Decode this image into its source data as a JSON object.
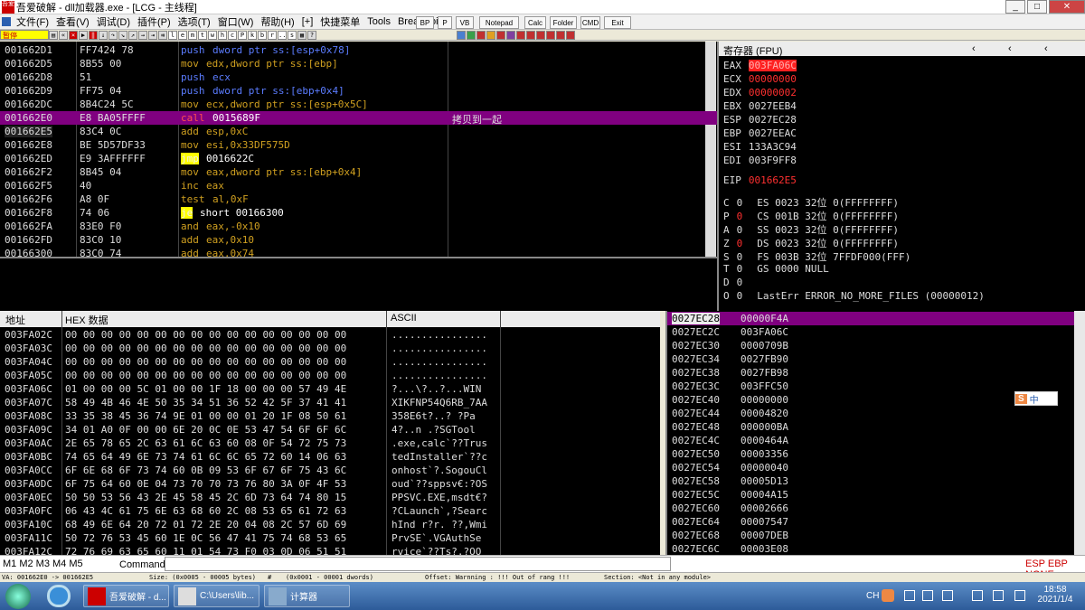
{
  "window": {
    "title": "吾爱破解 - dll加载器.exe - [LCG - 主线程]",
    "logo": "吾爱"
  },
  "menu": [
    "文件(F)",
    "查看(V)",
    "调试(D)",
    "插件(P)",
    "选项(T)",
    "窗口(W)",
    "帮助(H)",
    "[+]",
    "快捷菜单",
    "Tools",
    "BreakPoint"
  ],
  "toolbar": {
    "status": "暂停",
    "letters": [
      "l",
      "e",
      "m",
      "t",
      "w",
      "h",
      "c",
      "P",
      "k",
      "b",
      "r",
      "...",
      "s"
    ]
  },
  "tabs": [
    "BP",
    "P",
    "VB",
    "Notepad",
    "Calc",
    "Folder",
    "CMD",
    "Exit"
  ],
  "disasm": [
    {
      "addr": "001662D1",
      "hex": "FF7424 78",
      "mn": "push",
      "ops": "dword ptr ss:[esp+0x78]",
      "cmt": ""
    },
    {
      "addr": "001662D5",
      "hex": "8B55 00",
      "mn": "mov",
      "ops": "edx,dword ptr ss:[ebp]",
      "cmt": ""
    },
    {
      "addr": "001662D8",
      "hex": "51",
      "mn": "push",
      "ops": "ecx",
      "cmt": ""
    },
    {
      "addr": "001662D9",
      "hex": "FF75 04",
      "mn": "push",
      "ops": "dword ptr ss:[ebp+0x4]",
      "cmt": ""
    },
    {
      "addr": "001662DC",
      "hex": "8B4C24 5C",
      "mn": "mov",
      "ops": "ecx,dword ptr ss:[esp+0x5C]",
      "cmt": ""
    },
    {
      "addr": "001662E0",
      "hex": "E8 BA05FFFF",
      "mn": "call",
      "ops": "0015689F",
      "cmt": "拷贝到一起"
    },
    {
      "addr": "001662E5",
      "hex": "83C4 0C",
      "mn": "add",
      "ops": "esp,0xC",
      "cmt": ""
    },
    {
      "addr": "001662E8",
      "hex": "BE 5D57DF33",
      "mn": "mov",
      "ops": "esi,0x33DF575D",
      "cmt": ""
    },
    {
      "addr": "001662ED",
      "hex": "E9 3AFFFFFF",
      "mn": "jmp",
      "ops": "0016622C",
      "cmt": ""
    },
    {
      "addr": "001662F2",
      "hex": "8B45 04",
      "mn": "mov",
      "ops": "eax,dword ptr ss:[ebp+0x4]",
      "cmt": ""
    },
    {
      "addr": "001662F5",
      "hex": "40",
      "mn": "inc",
      "ops": "eax",
      "cmt": ""
    },
    {
      "addr": "001662F6",
      "hex": "A8 0F",
      "mn": "test",
      "ops": "al,0xF",
      "cmt": ""
    },
    {
      "addr": "001662F8",
      "hex": "74 06",
      "mn": "je",
      "ops": "short 00166300",
      "cmt": ""
    },
    {
      "addr": "001662FA",
      "hex": "83E0 F0",
      "mn": "and",
      "ops": "eax,-0x10",
      "cmt": ""
    },
    {
      "addr": "001662FD",
      "hex": "83C0 10",
      "mn": "add",
      "ops": "eax,0x10",
      "cmt": ""
    },
    {
      "addr": "00166300",
      "hex": "83C0 74",
      "mn": "add",
      "ops": "eax,0x74",
      "cmt": ""
    }
  ],
  "registers": {
    "title": "寄存器 (FPU)",
    "gpr": [
      {
        "n": "EAX",
        "v": "003FA06C",
        "s": "hl"
      },
      {
        "n": "ECX",
        "v": "00000000",
        "s": "red"
      },
      {
        "n": "EDX",
        "v": "00000002",
        "s": "red"
      },
      {
        "n": "EBX",
        "v": "0027EEB4",
        "s": ""
      },
      {
        "n": "ESP",
        "v": "0027EC28",
        "s": ""
      },
      {
        "n": "EBP",
        "v": "0027EEAC",
        "s": ""
      },
      {
        "n": "ESI",
        "v": "133A3C94",
        "s": ""
      },
      {
        "n": "EDI",
        "v": "003F9FF8",
        "s": ""
      }
    ],
    "eip": {
      "n": "EIP",
      "v": "001662E5"
    },
    "flags": [
      {
        "f": "C",
        "v": "0",
        "rest": "ES 0023 32位 0(FFFFFFFF)",
        "r": false
      },
      {
        "f": "P",
        "v": "0",
        "rest": "CS 001B 32位 0(FFFFFFFF)",
        "r": true
      },
      {
        "f": "A",
        "v": "0",
        "rest": "SS 0023 32位 0(FFFFFFFF)",
        "r": false
      },
      {
        "f": "Z",
        "v": "0",
        "rest": "DS 0023 32位 0(FFFFFFFF)",
        "r": true
      },
      {
        "f": "S",
        "v": "0",
        "rest": "FS 003B 32位 7FFDF000(FFF)",
        "r": false
      },
      {
        "f": "T",
        "v": "0",
        "rest": "GS 0000 NULL",
        "r": false
      },
      {
        "f": "D",
        "v": "0",
        "rest": "",
        "r": false
      },
      {
        "f": "O",
        "v": "0",
        "rest": "LastErr ERROR_NO_MORE_FILES (00000012)",
        "r": false
      }
    ]
  },
  "dump": {
    "headers": {
      "addr": "地址",
      "hex": "HEX 数据",
      "ascii": "ASCII"
    },
    "rows": [
      {
        "a": "003FA02C",
        "h": "00 00 00 00 00 00 00 00 00 00 00 00 00 00 00 00",
        "t": "................"
      },
      {
        "a": "003FA03C",
        "h": "00 00 00 00 00 00 00 00 00 00 00 00 00 00 00 00",
        "t": "................"
      },
      {
        "a": "003FA04C",
        "h": "00 00 00 00 00 00 00 00 00 00 00 00 00 00 00 00",
        "t": "................"
      },
      {
        "a": "003FA05C",
        "h": "00 00 00 00 00 00 00 00 00 00 00 00 00 00 00 00",
        "t": "................"
      },
      {
        "a": "003FA06C",
        "h": "01 00 00 00 5C 01 00 00 1F 18 00 00 00 57 49 4E",
        "t": "?...\\?..?...WIN"
      },
      {
        "a": "003FA07C",
        "h": "58 49 4B 46 4E 50 35 34 51 36 52 42 5F 37 41 41",
        "t": "XIKFNP54Q6RB_7AA"
      },
      {
        "a": "003FA08C",
        "h": "33 35 38 45 36 74 9E 01 00 00 01 20 1F 08 50 61",
        "t": "358E6t?..? ?Pa"
      },
      {
        "a": "003FA09C",
        "h": "34 01 A0 0F 00 00 6E 20 0C 0E 53 47 54 6F 6F 6C",
        "t": "4?..n .?SGTool"
      },
      {
        "a": "003FA0AC",
        "h": "2E 65 78 65 2C 63 61 6C 63 60 08 0F 54 72 75 73",
        "t": ".exe,calc`??Trus"
      },
      {
        "a": "003FA0BC",
        "h": "74 65 64 49 6E 73 74 61 6C 6C 65 72 60 14 06 63",
        "t": "tedInstaller`??c"
      },
      {
        "a": "003FA0CC",
        "h": "6F 6E 68 6F 73 74 60 0B 09 53 6F 67 6F 75 43 6C",
        "t": "onhost`?.SogouCl"
      },
      {
        "a": "003FA0DC",
        "h": "6F 75 64 60 0E 04 73 70 70 73 76 80 3A 0F 4F 53",
        "t": "oud`??sppsv€:?OS"
      },
      {
        "a": "003FA0EC",
        "h": "50 50 53 56 43 2E 45 58 45 2C 6D 73 64 74 80 15",
        "t": "PPSVC.EXE,msdt€?"
      },
      {
        "a": "003FA0FC",
        "h": "06 43 4C 61 75 6E 63 68 60 2C 08 53 65 61 72 63",
        "t": "?CLaunch`,?Searc"
      },
      {
        "a": "003FA10C",
        "h": "68 49 6E 64 20 72 01 72 2E 20 04 08 2C 57 6D 69",
        "t": "hInd r?r. ??,Wmi"
      },
      {
        "a": "003FA11C",
        "h": "50 72 76 53 45 60 1E 0C 56 47 41 75 74 68 53 65",
        "t": "PrvSE`.VGAuthSe"
      },
      {
        "a": "003FA12C",
        "h": "72 76 69 63 65 60 11 01 54 73 F0 03 0D 06 51 51",
        "t": "rvice`??Ts?.?OO"
      }
    ]
  },
  "stack": [
    {
      "a": "0027EC28",
      "v": "00000F4A"
    },
    {
      "a": "0027EC2C",
      "v": "003FA06C"
    },
    {
      "a": "0027EC30",
      "v": "0000709B"
    },
    {
      "a": "0027EC34",
      "v": "0027FB90"
    },
    {
      "a": "0027EC38",
      "v": "0027FB98"
    },
    {
      "a": "0027EC3C",
      "v": "003FFC50"
    },
    {
      "a": "0027EC40",
      "v": "00000000"
    },
    {
      "a": "0027EC44",
      "v": "00004820"
    },
    {
      "a": "0027EC48",
      "v": "000000BA"
    },
    {
      "a": "0027EC4C",
      "v": "0000464A"
    },
    {
      "a": "0027EC50",
      "v": "00003356"
    },
    {
      "a": "0027EC54",
      "v": "00000040"
    },
    {
      "a": "0027EC58",
      "v": "00005D13"
    },
    {
      "a": "0027EC5C",
      "v": "00004A15"
    },
    {
      "a": "0027EC60",
      "v": "00002666"
    },
    {
      "a": "0027EC64",
      "v": "00007547"
    },
    {
      "a": "0027EC68",
      "v": "00007DEB"
    },
    {
      "a": "0027EC6C",
      "v": "00003E08"
    }
  ],
  "cmd": {
    "tabs": "M1 M2 M3 M4 M5",
    "label": "Command",
    "right": "ESP EBP NONE"
  },
  "status": {
    "va": "VA: 001662E0 -> 001662E5",
    "size": "Size: (0x0005 - 00005 bytes)",
    "hash": "#",
    "dw": "(0x0001 - 00001 dwords)",
    "offset": "Offset: Warnning : !!! Out of rang !!!",
    "section": "Section: <Not in any module>"
  },
  "ime": "中",
  "taskbar": {
    "items": [
      "吾爱破解 - d...",
      "C:\\Users\\lib...",
      "计算器"
    ],
    "time": "18:58",
    "date": "2021/1/4",
    "tray_lang": "CH"
  }
}
